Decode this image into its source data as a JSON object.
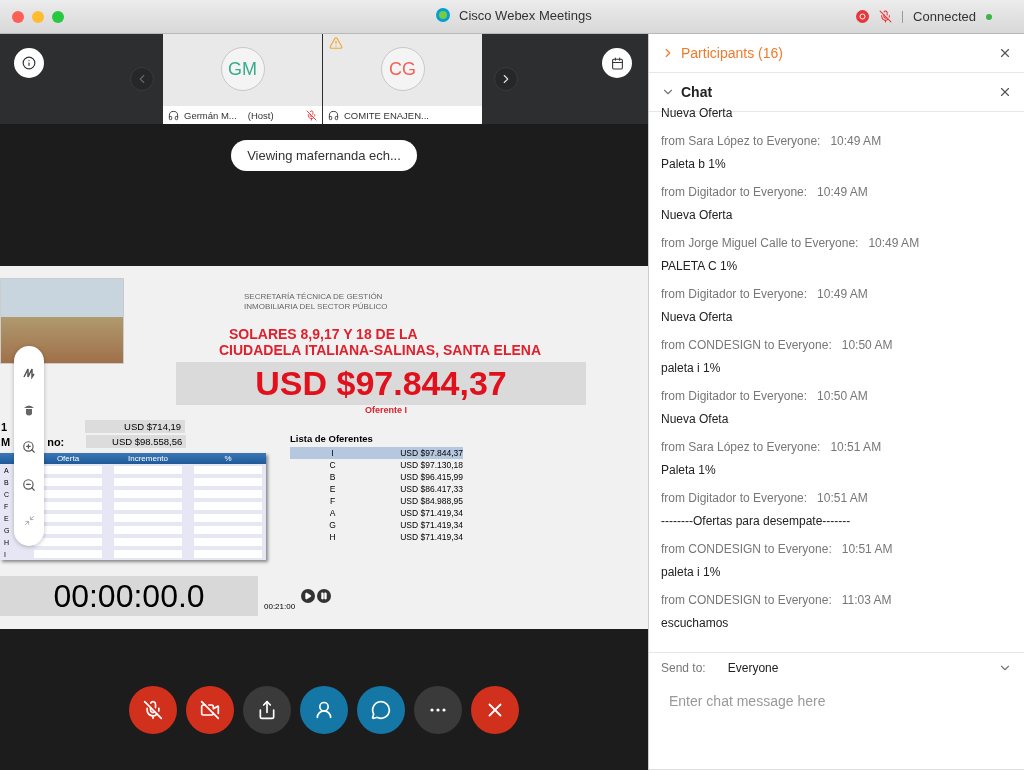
{
  "window": {
    "title": "Cisco Webex Meetings",
    "status": "Connected",
    "recording": true,
    "muted": true
  },
  "participant_tiles": [
    {
      "initials": "GM",
      "name": "Germán M...",
      "role": "(Host)",
      "muted": true,
      "warning": false,
      "color": "#3aaa8c"
    },
    {
      "initials": "CG",
      "name": "COMITE ENAJEN...",
      "muted": false,
      "warning": true,
      "color": "#f0625a"
    }
  ],
  "viewing_label": "Viewing mafernanda ech...",
  "shared_slide": {
    "org_line_1": "SECRETARÍA TÉCNICA DE GESTIÓN",
    "org_line_2": "INMOBILIARIA DEL SECTOR PÚBLICO",
    "title_line_1": "SOLARES 8,9,17 Y 18 DE LA",
    "title_line_2": "CIUDADELA ITALIANA-SALINAS, SANTA ELENA",
    "amount": "USD $97.844,37",
    "winner": "Oferente I",
    "summary": [
      {
        "label": "1",
        "value": "USD $714,19"
      },
      {
        "label": "M",
        "label_tail": "no:",
        "value": "USD $98.558,56"
      }
    ],
    "bid_table": {
      "columns": [
        "Oferta",
        "Incremento",
        "%"
      ],
      "rows": [
        "A",
        "B",
        "C",
        "F",
        "E",
        "G",
        "H",
        "I"
      ]
    },
    "list_title": "Lista de Oferentes",
    "bidders": [
      {
        "letter": "I",
        "amount": "USD $97.844,37",
        "selected": true
      },
      {
        "letter": "C",
        "amount": "USD $97.130,18",
        "selected": false
      },
      {
        "letter": "B",
        "amount": "USD $96.415,99",
        "selected": false
      },
      {
        "letter": "E",
        "amount": "USD $86.417,33",
        "selected": false
      },
      {
        "letter": "F",
        "amount": "USD $84.988,95",
        "selected": false
      },
      {
        "letter": "A",
        "amount": "USD $71.419,34",
        "selected": false
      },
      {
        "letter": "G",
        "amount": "USD $71.419,34",
        "selected": false
      },
      {
        "letter": "H",
        "amount": "USD $71.419,34",
        "selected": false
      }
    ],
    "timer": "00:00:00.0",
    "timer_setting": "00:21:00"
  },
  "controls": [
    {
      "kind": "mute",
      "active": true
    },
    {
      "kind": "video",
      "active": true
    },
    {
      "kind": "share",
      "active": false
    },
    {
      "kind": "participants",
      "active": true
    },
    {
      "kind": "chat",
      "active": true
    },
    {
      "kind": "more",
      "active": false
    },
    {
      "kind": "leave",
      "active": true
    }
  ],
  "panel": {
    "participants": {
      "title": "Participants (16)",
      "expanded": false
    },
    "chat": {
      "title": "Chat",
      "expanded": true
    }
  },
  "chat_messages": [
    {
      "text": "Nueva Oferta"
    },
    {
      "from": "from Sara López to Everyone:",
      "time": "10:49  AM",
      "text": "Paleta b 1%"
    },
    {
      "from": "from Digitador to Everyone:",
      "time": "10:49  AM",
      "text": "Nueva Oferta"
    },
    {
      "from": "from Jorge Miguel Calle to Everyone:",
      "time": "10:49  AM",
      "text": "PALETA C 1%"
    },
    {
      "from": "from Digitador to Everyone:",
      "time": "10:49  AM",
      "text": "Nueva Oferta"
    },
    {
      "from": "from CONDESIGN to Everyone:",
      "time": "10:50  AM",
      "text": "paleta i 1%"
    },
    {
      "from": "from Digitador to Everyone:",
      "time": "10:50  AM",
      "text": "Nueva Ofeta"
    },
    {
      "from": "from Sara López to Everyone:",
      "time": "10:51  AM",
      "text": "Paleta 1%"
    },
    {
      "from": "from Digitador to Everyone:",
      "time": "10:51  AM",
      "text": "--------Ofertas para desempate-------"
    },
    {
      "from": "from CONDESIGN to Everyone:",
      "time": "10:51  AM",
      "text": "paleta i 1%"
    },
    {
      "from": "from CONDESIGN to Everyone:",
      "time": "11:03  AM",
      "text": "escuchamos"
    }
  ],
  "send_to": {
    "label": "Send to:",
    "value": "Everyone"
  },
  "chat_input": {
    "placeholder": "Enter chat message here"
  }
}
